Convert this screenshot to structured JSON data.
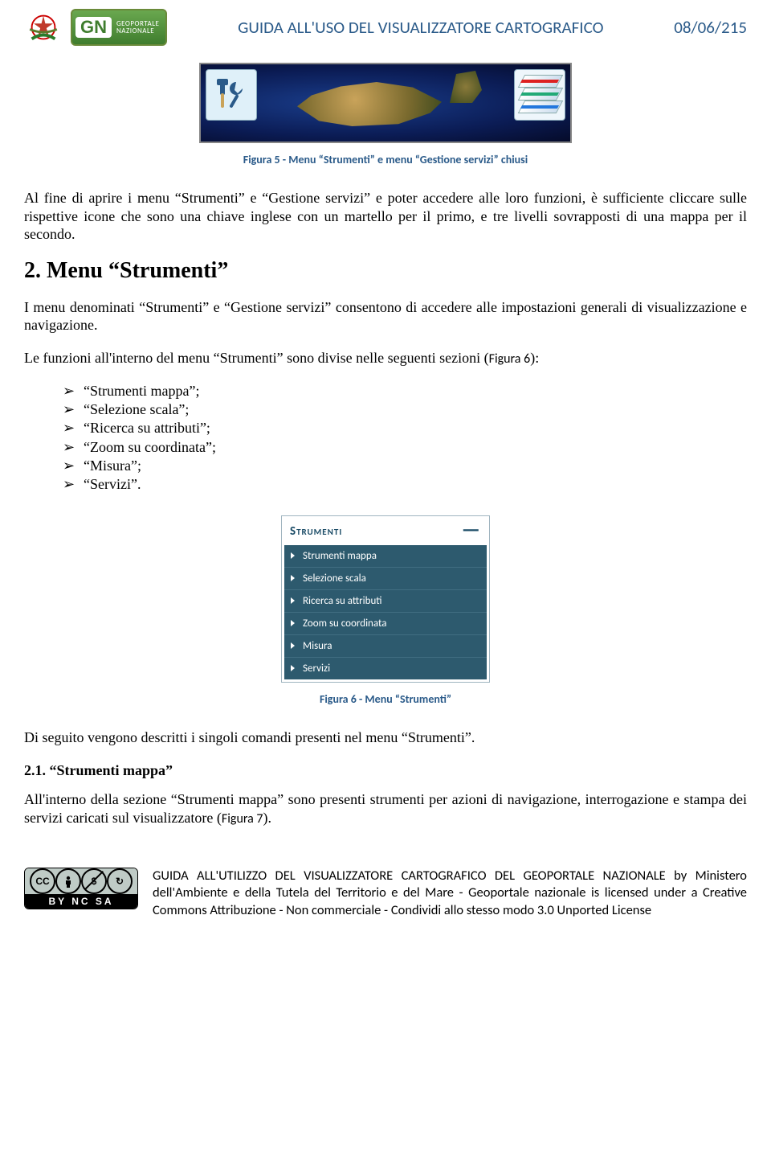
{
  "header": {
    "badge_abbrev": "GN",
    "badge_line1": "GEOPORTALE",
    "badge_line2": "NAZIONALE",
    "title": "GUIDA ALL'USO DEL VISUALIZZATORE CARTOGRAFICO",
    "date": "08/06/215"
  },
  "figure5": {
    "caption": "Figura 5 - Menu “Strumenti” e menu “Gestione servizi” chiusi",
    "tools_icon_name": "hammer-wrench-icon",
    "layers_icon_name": "map-layers-icon"
  },
  "para1": "Al fine di aprire i menu “Strumenti” e “Gestione servizi” e poter accedere alle loro funzioni, è sufficiente cliccare sulle rispettive icone che sono una chiave inglese con un martello per il primo, e tre livelli sovrapposti di una mappa per il secondo.",
  "section2_title": "2. Menu “Strumenti”",
  "para2": "I menu denominati “Strumenti” e “Gestione servizi” consentono di accedere alle impostazioni generali di visualizzazione e navigazione.",
  "para3_pre": "Le funzioni all'interno del menu “Strumenti” sono divise nelle seguenti sezioni (",
  "para3_ref": "Figura 6",
  "para3_post": "):",
  "bullets": [
    "“Strumenti mappa”;",
    "“Selezione scala”;",
    "“Ricerca su attributi”;",
    "“Zoom su coordinata”;",
    "“Misura”;",
    "“Servizi”."
  ],
  "menu": {
    "title": "Strumenti",
    "items": [
      "Strumenti mappa",
      "Selezione scala",
      "Ricerca su attributi",
      "Zoom su coordinata",
      "Misura",
      "Servizi"
    ]
  },
  "figure6_caption": "Figura 6 - Menu “Strumenti”",
  "para4": "Di seguito vengono descritti i singoli comandi presenti nel menu “Strumenti”.",
  "section21_title": "2.1. “Strumenti mappa”",
  "para5_pre": "All'interno della sezione “Strumenti mappa” sono presenti strumenti per azioni di navigazione, interrogazione e stampa dei servizi caricati sul visualizzatore (",
  "para5_ref": "Figura 7",
  "para5_post": ").",
  "cc": {
    "cc": "CC",
    "by_glyph": "ⓘ",
    "nc_glyph": "$",
    "sa_glyph": "↻",
    "bottom": "BY   NC   SA"
  },
  "footer_text": "GUIDA ALL'UTILIZZO DEL VISUALIZZATORE CARTOGRAFICO DEL GEOPORTALE NAZIONALE by Ministero dell'Ambiente e della Tutela del Territorio e del Mare - Geoportale nazionale is licensed under a Creative Commons Attribuzione - Non commerciale - Condividi allo stesso modo 3.0 Unported License"
}
